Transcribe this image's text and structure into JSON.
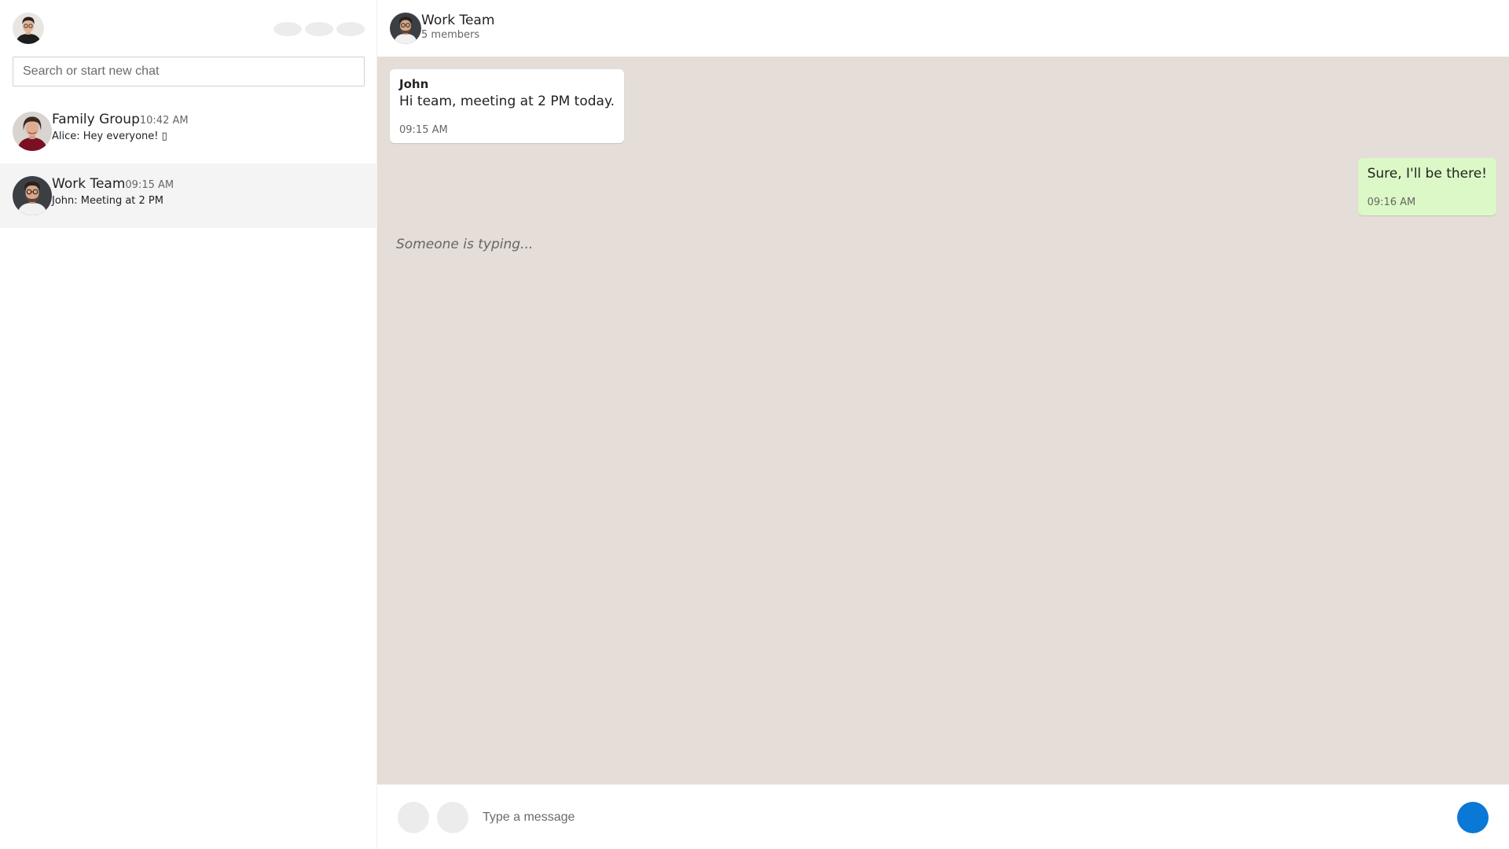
{
  "sidebar": {
    "my_avatar": "user-avatar",
    "actions": [
      "status-icon",
      "new-chat-icon",
      "menu-icon"
    ],
    "search": {
      "placeholder": "Search or start new chat",
      "value": ""
    },
    "chats": [
      {
        "name": "Family Group",
        "time": "10:42 AM",
        "last_message": "Alice: Hey everyone! ▯",
        "active": false
      },
      {
        "name": "Work Team",
        "time": "09:15 AM",
        "last_message": "John: Meeting at 2 PM",
        "active": true
      }
    ]
  },
  "chat": {
    "title": "Work Team",
    "members": "5 members",
    "messages": [
      {
        "direction": "in",
        "sender": "John",
        "text": "Hi team, meeting at 2 PM today.",
        "time": "09:15 AM"
      },
      {
        "direction": "out",
        "sender": "",
        "text": "Sure, I'll be there!",
        "time": "09:16 AM"
      }
    ],
    "typing_indicator": "Someone is typing...",
    "composer": {
      "placeholder": "Type a message",
      "value": ""
    }
  },
  "colors": {
    "chat_background": "#e5ddd7",
    "incoming_bubble": "#ffffff",
    "outgoing_bubble": "#dcf8c6",
    "send_button": "#0a78d7",
    "active_chat_row": "#f4f4f4"
  }
}
